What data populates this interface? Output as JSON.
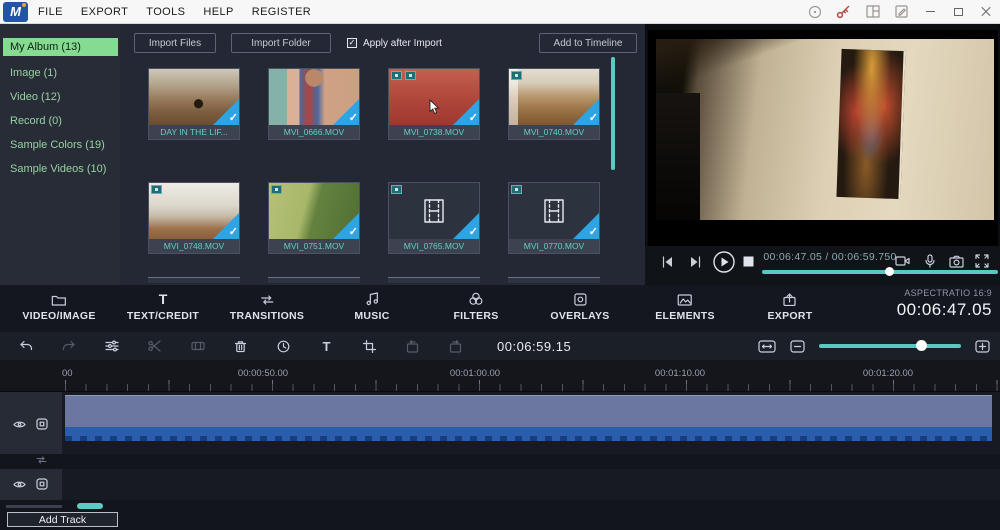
{
  "menu": {
    "items": [
      "FILE",
      "EXPORT",
      "TOOLS",
      "HELP",
      "REGISTER"
    ]
  },
  "titlebar_icons": [
    "whats-new-icon",
    "activation-key-icon",
    "layout-icon",
    "feedback-icon",
    "minimize-icon",
    "maximize-icon",
    "close-icon"
  ],
  "sidebar": {
    "items": [
      {
        "label": "My Album (13)",
        "selected": true
      },
      {
        "label": "Image (1)",
        "selected": false
      },
      {
        "label": "Video (12)",
        "selected": false
      },
      {
        "label": "Record (0)",
        "selected": false
      },
      {
        "label": "Sample Colors (19)",
        "selected": false
      },
      {
        "label": "Sample Videos (10)",
        "selected": false
      }
    ]
  },
  "library": {
    "import_files": "Import Files",
    "import_folder": "Import Folder",
    "apply_after_import": "Apply after Import",
    "apply_checked": true,
    "add_to_timeline": "Add to Timeline",
    "items": [
      {
        "name": "DAY IN THE LIF...",
        "art": "cluttered-room",
        "selected": true
      },
      {
        "name": "MVI_0666.MOV",
        "art": "person",
        "selected": true
      },
      {
        "name": "MVI_0738.MOV",
        "art": "red-room",
        "selected": true,
        "hovered": true
      },
      {
        "name": "MVI_0740.MOV",
        "art": "dining-room",
        "selected": true
      },
      {
        "name": "MVI_0748.MOV",
        "art": "white-room",
        "selected": true
      },
      {
        "name": "MVI_0751.MOV",
        "art": "grass",
        "selected": true
      },
      {
        "name": "MVI_0765.MOV",
        "art": "filmstrip",
        "selected": true
      },
      {
        "name": "MVI_0770.MOV",
        "art": "filmstrip",
        "selected": true
      }
    ]
  },
  "preview": {
    "time_display": "00:06:47.05 / 00:06:59.750",
    "progress_pct": 52
  },
  "tabs": [
    {
      "label": "VIDEO/IMAGE",
      "icon": "folder-icon"
    },
    {
      "label": "TEXT/CREDIT",
      "icon": "text-icon"
    },
    {
      "label": "TRANSITIONS",
      "icon": "transitions-icon"
    },
    {
      "label": "MUSIC",
      "icon": "music-icon"
    },
    {
      "label": "FILTERS",
      "icon": "filters-icon"
    },
    {
      "label": "OVERLAYS",
      "icon": "overlays-icon"
    },
    {
      "label": "ELEMENTS",
      "icon": "elements-icon"
    },
    {
      "label": "EXPORT",
      "icon": "export-icon"
    }
  ],
  "status": {
    "aspect_label": "ASPECTRATIO 16:9",
    "timecode": "00:06:47.05"
  },
  "toolbar": {
    "timecode": "00:06:59.15",
    "zoom_pct": 68,
    "icons": [
      "undo-icon",
      "redo-icon",
      "adjust-icon",
      "cut-icon",
      "detach-icon",
      "delete-icon",
      "speed-icon",
      "text-tool-icon",
      "crop-icon",
      "box-arrow-left-icon",
      "box-arrow-right-icon",
      "fit-timeline-icon",
      "zoom-out-icon",
      "zoom-in-icon"
    ]
  },
  "ruler": {
    "labels": [
      "00",
      "00:00:50.00",
      "00:01:00.00",
      "00:01:10.00",
      "00:01:20.00"
    ]
  },
  "tracks": {
    "add_track_label": "Add Track"
  },
  "colors": {
    "accent_teal": "#5fc9c3",
    "accent_green": "#85dc90",
    "select_blue": "#2da5e2",
    "clip_blue": "#2a5dab"
  }
}
